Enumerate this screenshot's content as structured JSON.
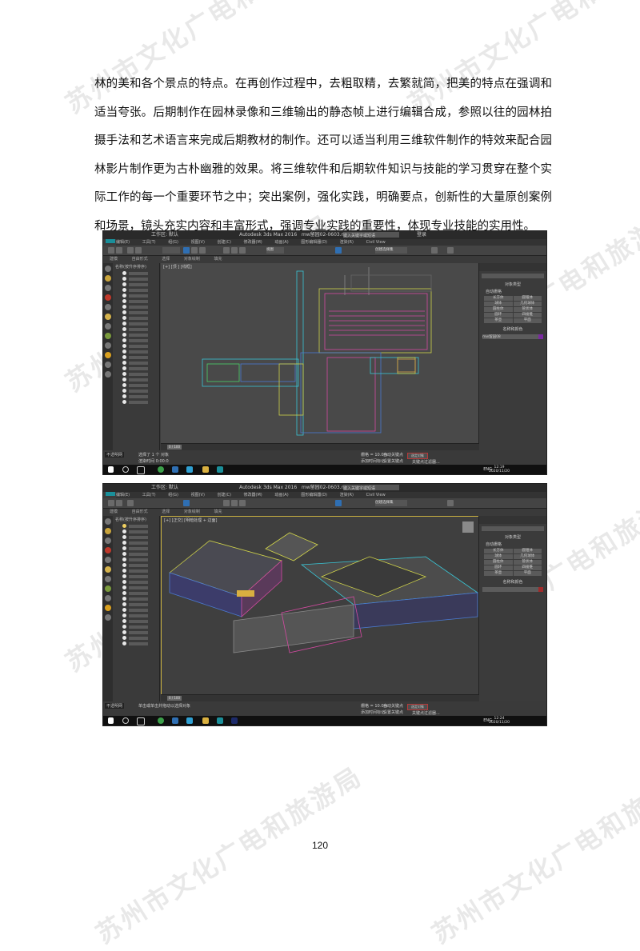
{
  "watermark": "苏州市文化广电和旅游局",
  "paragraph": "林的美和各个景点的特点。在再创作过程中，去粗取精，去繁就简，把美的特点在强调和适当夸张。后期制作在园林录像和三维输出的静态帧上进行编辑合成，参照以往的园林拍摄手法和艺术语言来完成后期教材的制作。还可以适当利用三维软件制作的特效来配合园林影片制作更为古朴幽雅的效果。将三维软件和后期软件知识与技能的学习贯穿在整个实际工作的每一个重要环节之中；突出案例，强化实践，明确要点，创新性的大量原创案例和场景，镜头充实内容和丰富形式，强调专业实践的重要性，体现专业技能的实用性。",
  "screenshot1": {
    "workspace": "工作区: 默认",
    "app_title": "Autodesk 3ds Max 2016",
    "file_name": "mw留园02-0603.max",
    "search_placeholder": "键入关键字或短语",
    "login": "登录",
    "menus": [
      "编辑(E)",
      "工具(T)",
      "组(G)",
      "视图(V)",
      "创建(C)",
      "修改器(M)",
      "动画(A)",
      "图形编辑器(D)",
      "渲染(R)",
      "Civil View"
    ],
    "selection_set": "创建选择集",
    "view_mode": "视图",
    "ribbon_tabs": [
      "建模",
      "自由形式",
      "选择",
      "对象绘制",
      "填充"
    ],
    "scene_header": "名称(按升序排序)",
    "viewport_label": "[+] [顶 ] [线框]",
    "object_type_title": "对象类型",
    "autogrid": "自动栅格",
    "object_buttons": [
      "长方体",
      "圆锥体",
      "球体",
      "几何球体",
      "圆柱体",
      "管状体",
      "圆环",
      "四棱锥",
      "茶壶",
      "平面"
    ],
    "name_color_title": "名称和颜色",
    "object_name": "mw留园08",
    "frame_counter": "0 / 100",
    "status_left": "不透明网",
    "status_msg1": "选择了 1 个 对象",
    "status_msg2": "渲染时间 0:00:0",
    "grid": "栅格 = 10.0m",
    "auto_key": "自动关键点",
    "set_key": "设置关键点",
    "selected_obj": "选定对象",
    "key_filter": "关键点过滤器...",
    "time_tag": "添加时间标记",
    "lang": "ENG",
    "clock_time": "12:19",
    "clock_date": "2020/11/20"
  },
  "screenshot2": {
    "workspace": "工作区: 默认",
    "app_title": "Autodesk 3ds Max 2016",
    "file_name": "mw留园02-0603.max",
    "search_placeholder": "键入关键字或短语",
    "viewport_label": "[+] [正交] [明暗处理 + 边面]",
    "selection_set": "创建选择集",
    "object_type_title": "对象类型",
    "name_color_title": "名称和颜色",
    "frame_counter": "0 / 100",
    "status_left": "不透明网",
    "status_msg1": "单击或单击并拖动以选择对象",
    "grid": "栅格 = 10.0m",
    "auto_key": "自动关键点",
    "set_key": "设置关键点",
    "selected_obj": "选定对象",
    "key_filter": "关键点过滤器...",
    "time_tag": "添加时间标记",
    "lang": "ENG",
    "clock_time": "12:24",
    "clock_date": "2020/11/20"
  },
  "page_number": "120",
  "colors": {
    "viewport_bg": "#4a4a4a",
    "ui_bg": "#3c3c3c",
    "taskbar": "#101010",
    "accent_blue": "#2f6fb3"
  }
}
